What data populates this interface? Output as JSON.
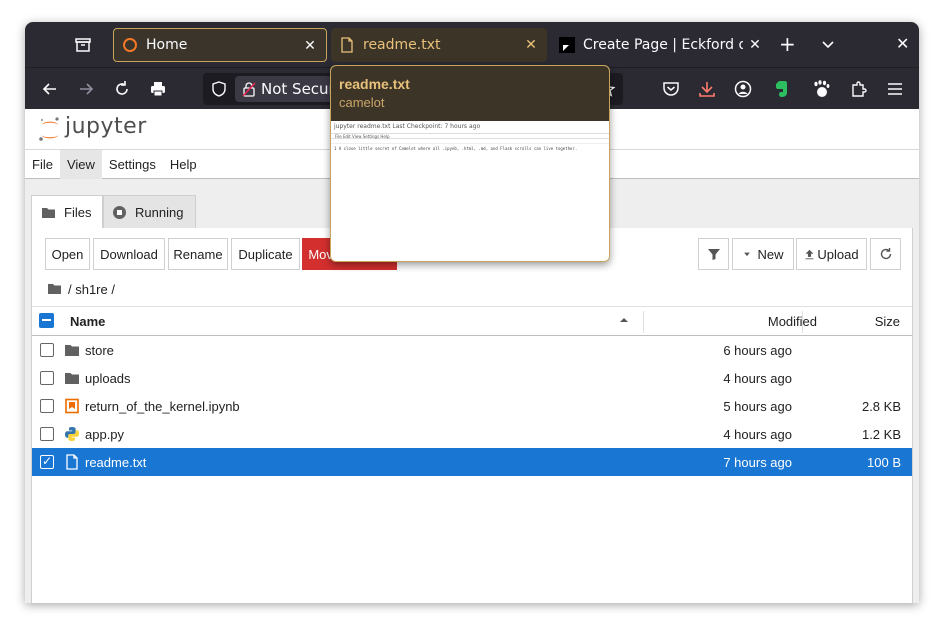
{
  "browser": {
    "tabs": [
      {
        "label": "Home"
      },
      {
        "label": "readme.txt"
      },
      {
        "label": "Create Page | Eckford on"
      }
    ],
    "new_tab": "+",
    "url_security_label": "Not Secure",
    "preview": {
      "title": "readme.txt",
      "host": "camelot",
      "thumb_header": "jupyter   readme.txt   Last Checkpoint: 7 hours ago",
      "thumb_menu": "File   Edit   View   Settings   Help",
      "thumb_text": "1  A close little secret of Camelot where all .ipynb, .html, .md, and Flask scrolls can live together."
    }
  },
  "jupyter": {
    "brand": "jupyter",
    "menu": [
      {
        "label": "File"
      },
      {
        "label": "View"
      },
      {
        "label": "Settings"
      },
      {
        "label": "Help"
      }
    ],
    "side_tabs": {
      "files": "Files",
      "running": "Running"
    },
    "toolbar": {
      "open": "Open",
      "download": "Download",
      "rename": "Rename",
      "duplicate": "Duplicate",
      "move_to_trash": "Move to Trash",
      "new": "New",
      "upload": "Upload"
    },
    "breadcrumb": "/ sh1re /",
    "columns": {
      "name": "Name",
      "modified": "Modified",
      "size": "Size"
    },
    "files": [
      {
        "name": "store",
        "modified": "6 hours ago",
        "size": "",
        "type": "folder",
        "selected": false
      },
      {
        "name": "uploads",
        "modified": "4 hours ago",
        "size": "",
        "type": "folder",
        "selected": false
      },
      {
        "name": "return_of_the_kernel.ipynb",
        "modified": "5 hours ago",
        "size": "2.8 KB",
        "type": "notebook",
        "selected": false
      },
      {
        "name": "app.py",
        "modified": "4 hours ago",
        "size": "1.2 KB",
        "type": "python",
        "selected": false
      },
      {
        "name": "readme.txt",
        "modified": "7 hours ago",
        "size": "100 B",
        "type": "text",
        "selected": true
      }
    ]
  },
  "colors": {
    "browser_chrome": "#2b2a33",
    "active_tab_accent": "#e8c17a",
    "selection": "#1976d2",
    "danger": "#d32f2f",
    "jupyter_orange": "#f37726"
  }
}
